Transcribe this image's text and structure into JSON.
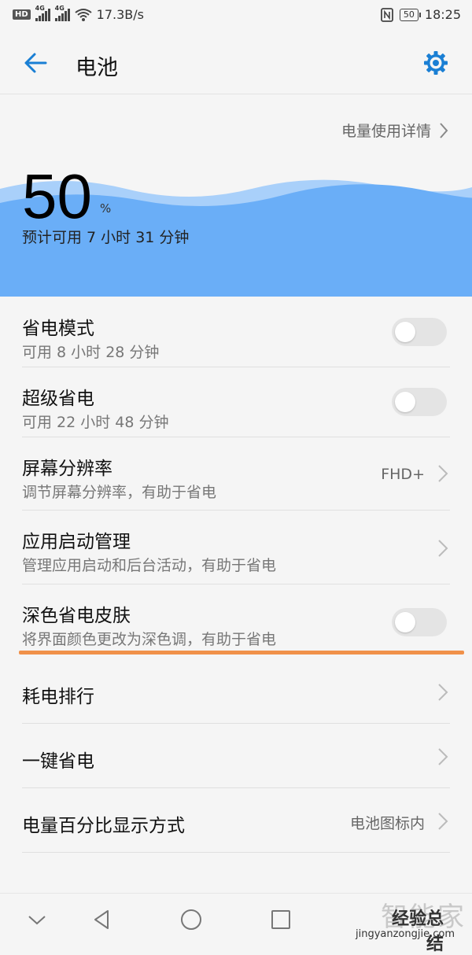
{
  "status_bar": {
    "hd": "HD",
    "net1": "4G",
    "net2": "4G",
    "speed": "17.3B/s",
    "battery": "50",
    "time": "18:25"
  },
  "header": {
    "title": "电池"
  },
  "battery": {
    "detail_link": "电量使用详情",
    "percent": "50",
    "percent_sign": "%",
    "estimate": "预计可用 7 小时 31 分钟",
    "wave_color": "#6aaef7"
  },
  "settings": {
    "power_saving": {
      "label": "省电模式",
      "sub": "可用 8 小时 28 分钟",
      "enabled": false
    },
    "ultra_saving": {
      "label": "超级省电",
      "sub": "可用 22 小时 48 分钟",
      "enabled": false
    },
    "resolution": {
      "label": "屏幕分辨率",
      "sub": "调节屏幕分辨率，有助于省电",
      "value": "FHD+"
    },
    "app_launch": {
      "label": "应用启动管理",
      "sub": "管理应用启动和后台活动，有助于省电"
    },
    "dark_skin": {
      "label": "深色省电皮肤",
      "sub": "将界面颜色更改为深色调，有助于省电",
      "enabled": false
    },
    "ranking": {
      "label": "耗电排行"
    },
    "one_key": {
      "label": "一键省电"
    },
    "percent_display": {
      "label": "电量百分比显示方式",
      "value": "电池图标内"
    }
  },
  "watermark": {
    "big": "智能家",
    "brand": "经验总结",
    "url": "jingyanzongjie.com"
  },
  "colors": {
    "accent": "#1a7fd4",
    "highlight": "#f0914a"
  }
}
